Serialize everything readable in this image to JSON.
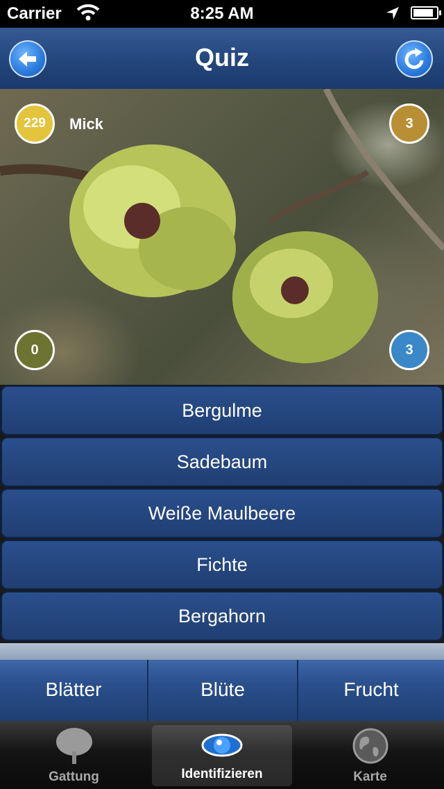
{
  "status_bar": {
    "carrier": "Carrier",
    "time": "8:25 AM"
  },
  "nav": {
    "title": "Quiz"
  },
  "quiz": {
    "player_score": "229",
    "player_name": "Mick",
    "top_right_count": "3",
    "bottom_left_count": "0",
    "bottom_right_count": "3"
  },
  "answers": [
    "Bergulme",
    "Sadebaum",
    "Weiße Maulbeere",
    "Fichte",
    "Bergahorn"
  ],
  "categories": [
    "Blätter",
    "Blüte",
    "Frucht"
  ],
  "tabs": [
    "Gattung",
    "Identifizieren",
    "Karte"
  ],
  "colors": {
    "nav_blue": "#24477e",
    "answer_blue": "#203f73",
    "score_yellow": "#e3c43b",
    "badge_gold": "#b98f35",
    "badge_olive": "#6d7330",
    "badge_blue": "#3b88c8"
  }
}
